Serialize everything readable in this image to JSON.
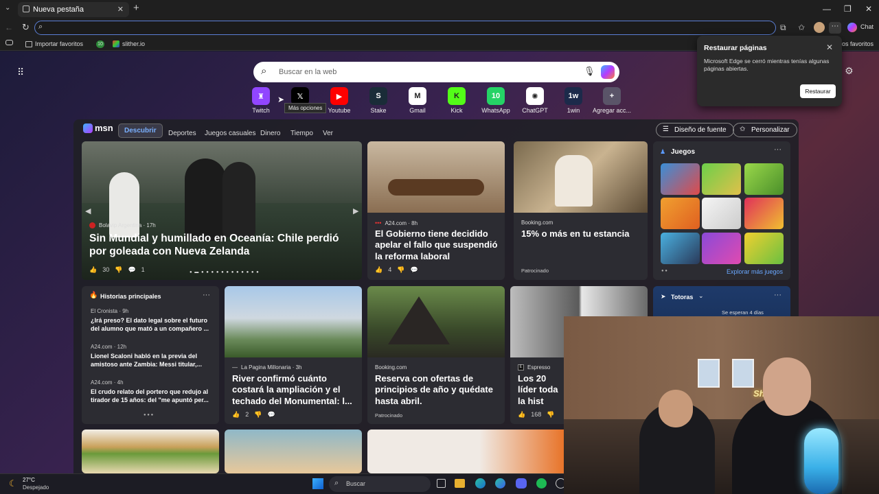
{
  "browser": {
    "tab_title": "Nueva pestaña",
    "chat_label": "Chat",
    "favorites_bar": {
      "import_label": "Importar favoritos",
      "badge": "10",
      "slither_label": "slither.io",
      "other_label": "os favoritos"
    }
  },
  "popup": {
    "title": "Restaurar páginas",
    "message": "Microsoft Edge se cerró mientras tenías algunas páginas abiertas.",
    "button": "Restaurar"
  },
  "newtab": {
    "search_placeholder": "Buscar en la web",
    "tooltip": "Más opciones",
    "tiles": [
      {
        "label": "Twitch",
        "icon": "twitch-icon",
        "color": "#9146ff",
        "glyph": "♜"
      },
      {
        "label": "",
        "icon": "x-icon",
        "color": "#000000",
        "glyph": "𝕏"
      },
      {
        "label": "Youtube",
        "icon": "youtube-icon",
        "color": "#ff0000",
        "glyph": "▶"
      },
      {
        "label": "Stake",
        "icon": "stake-icon",
        "color": "#1a2c38",
        "glyph": "S"
      },
      {
        "label": "Gmail",
        "icon": "gmail-icon",
        "color": "#ffffff",
        "glyph": "M"
      },
      {
        "label": "Kick",
        "icon": "kick-icon",
        "color": "#53fc18",
        "glyph": "K"
      },
      {
        "label": "WhatsApp",
        "icon": "whatsapp-icon",
        "color": "#25d366",
        "glyph": "10"
      },
      {
        "label": "ChatGPT",
        "icon": "chatgpt-icon",
        "color": "#ffffff",
        "glyph": "✺"
      },
      {
        "label": "1win",
        "icon": "onewin-icon",
        "color": "#1c2a4a",
        "glyph": "1w"
      },
      {
        "label": "Agregar acc...",
        "icon": "add-icon",
        "color": "#5a5468",
        "glyph": "+"
      }
    ]
  },
  "msn": {
    "logo": "msn",
    "nav": [
      "Descubrir",
      "Deportes",
      "Juegos casuales",
      "Dinero",
      "Tiempo",
      "Ver"
    ],
    "design_button": "Diseño de fuente",
    "personalize_button": "Personalizar",
    "hero": {
      "source": "Bolavip Argentina · 17h",
      "title": "Sin Mundial y humillado en Oceanía: Chile perdió por goleada con Nueva Zelanda",
      "likes": "30",
      "comments": "1"
    },
    "card_gov": {
      "source": "A24.com · 8h",
      "title": "El Gobierno tiene decidido apelar el fallo que suspendió la reforma laboral",
      "likes": "4"
    },
    "card_booking1": {
      "source": "Booking.com",
      "title": "15% o más en tu estancia",
      "sponsor": "Patrocinado"
    },
    "games": {
      "title": "Juegos",
      "more": "Explorar más juegos"
    },
    "top_stories": {
      "title": "Historias principales",
      "items": [
        {
          "source": "El Cronista · 9h",
          "title": "¿Irá preso? El dato legal sobre el futuro del alumno que mató a un compañero ..."
        },
        {
          "source": "A24.com · 12h",
          "title": "Lionel Scaloni habló en la previa del amistoso ante Zambia: Messi titular,..."
        },
        {
          "source": "A24.com · 4h",
          "title": "El crudo relato del portero que redujo al tirador de 15 años: del \"me apuntó per..."
        }
      ]
    },
    "card_river": {
      "source": "La Pagina Millonaria · 3h",
      "title": "River confirmó cuánto costará la ampliación y el techado del Monumental: l...",
      "likes": "2"
    },
    "card_booking2": {
      "source": "Booking.com",
      "title": "Reserva con ofertas de principios de año y quédate hasta abril.",
      "sponsor": "Patrocinado"
    },
    "card_espresso": {
      "source": "Espresso",
      "title": "Los 20 líder toda la hist",
      "likes": "168"
    },
    "weather": {
      "location": "Totoras",
      "forecast": "Se esperan 4 días"
    }
  },
  "taskbar": {
    "temp": "27°C",
    "condition": "Despejado",
    "search": "Buscar"
  },
  "webcam": {
    "sign_text": "Shelbus"
  }
}
